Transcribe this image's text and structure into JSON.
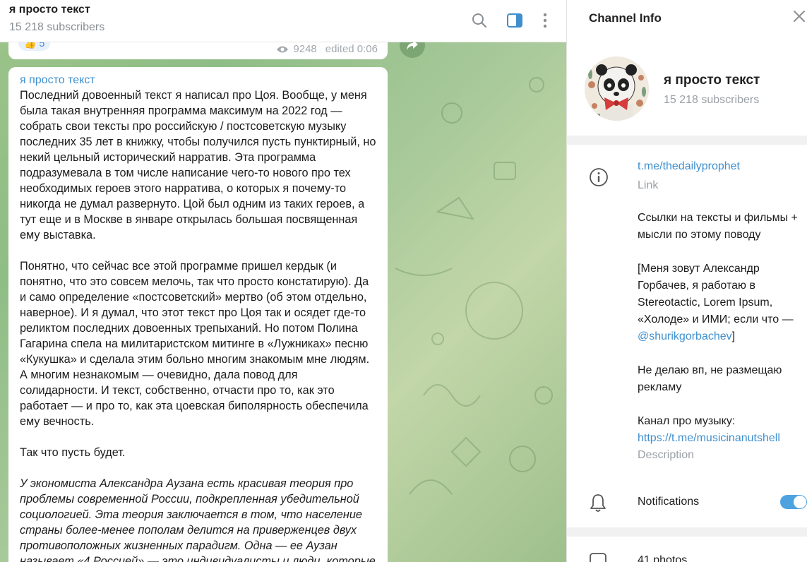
{
  "chat": {
    "title": "я просто текст",
    "subscribers": "15 218 subscribers",
    "prev_message": {
      "reaction_emoji": "👍",
      "reaction_count": "5",
      "views": "9248",
      "edited": "edited 0:06"
    },
    "message": {
      "author": "я просто текст",
      "paragraphs": [
        "Последний довоенный текст я написал про Цоя. Вообще, у меня была такая внутренняя программа максимум на 2022 год — собрать свои тексты про российскую / постсоветскую музыку последних 35 лет в книжку, чтобы получился пусть пунктирный, но некий цельный исторический нарратив. Эта программа подразумевала в том числе написание чего-то нового про тех необходимых героев этого нарратива, о которых я почему-то никогда не думал развернуто. Цой был одним из таких героев, а тут еще и в Москве в январе открылась большая посвященная ему выставка.",
        "Понятно, что сейчас все этой программе пришел кердык (и понятно, что это совсем мелочь, так что просто констатирую). Да и само определение «постсоветский» мертво (об этом отдельно, наверное). И я думал, что этот текст про Цоя так и осядет где-то реликтом последних довоенных трепыханий. Но потом Полина Гагарина спела на милитаристском митинге в «Лужниках» песню «Кукушка» и сделала этим больно многим знакомым мне людям. А многим незнакомым — очевидно, дала повод для солидарности. И текст, собственно, отчасти про то, как это работает — и про то, как эта цоевская биполярность обеспечила ему вечность.",
        "Так что пусть будет.",
        "У экономиста Александра Аузана есть красивая теория про проблемы современной России, подкрепленная убедительной социологией. Эта теория заключается в том, что население страны более-менее пополам делится на приверженцев двух противоположных жизненных парадигм. Одна — ее Аузан называет «4 Россией» — это индивидуалисты и люди, которые не"
      ]
    }
  },
  "info": {
    "title": "Channel Info",
    "channel_name": "я просто текст",
    "subscribers": "15 218 subscribers",
    "link": "t.me/thedailyprophet",
    "link_caption": "Link",
    "description": {
      "line1": "Ссылки на тексты и фильмы + мысли по этому поводу",
      "line2_prefix": "[Меня зовут Александр Горбачев, я работаю в Stereotactic, Lorem Ipsum, «Холоде» и ИМИ; если что — ",
      "line2_handle": "@shurikgorbachev",
      "line2_suffix": "]",
      "line3": "Не делаю вп, не размещаю рекламу",
      "line4": "Канал про музыку:",
      "line4_link": "https://t.me/musicinanutshell"
    },
    "description_caption": "Description",
    "notifications_label": "Notifications",
    "notifications_on": true,
    "photos_label": "41 photos"
  },
  "colors": {
    "accent": "#3f8fce",
    "toggle": "#4ea2e0",
    "muted": "#9aa0a6"
  },
  "icons": [
    "search-icon",
    "sidebar-toggle-icon",
    "more-vertical-icon",
    "close-icon",
    "info-icon",
    "bell-icon",
    "photo-icon",
    "eye-icon",
    "share-icon"
  ]
}
